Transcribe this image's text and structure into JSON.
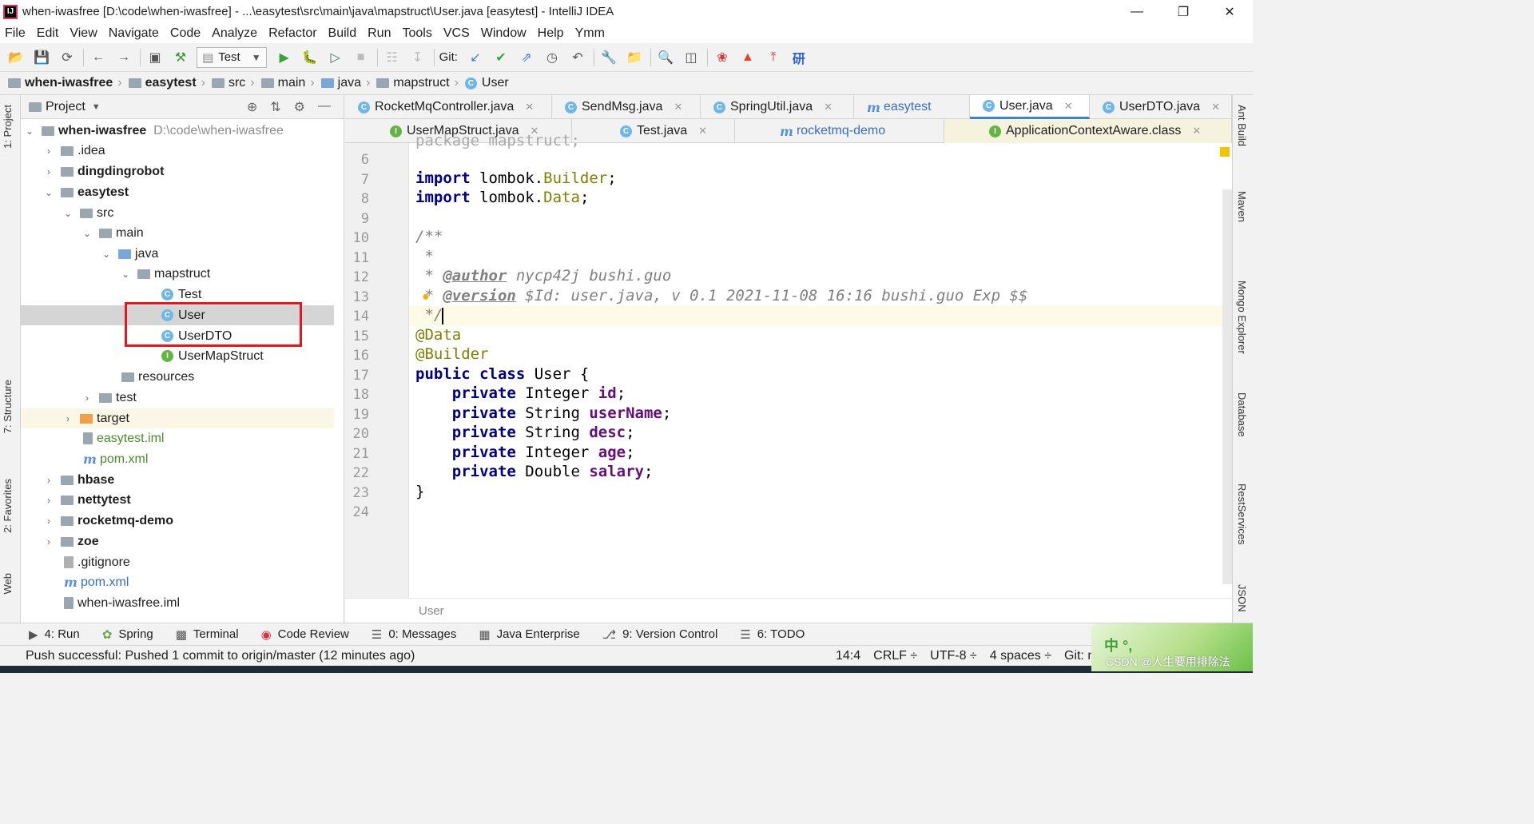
{
  "window": {
    "title": "when-iwasfree [D:\\code\\when-iwasfree] - ...\\easytest\\src\\main\\java\\mapstruct\\User.java [easytest] - IntelliJ IDEA",
    "app_icon": "IJ"
  },
  "menu": [
    "File",
    "Edit",
    "View",
    "Navigate",
    "Code",
    "Analyze",
    "Refactor",
    "Build",
    "Run",
    "Tools",
    "VCS",
    "Window",
    "Help",
    "Ymm"
  ],
  "toolbar": {
    "run_config": "Test",
    "git_label": "Git:"
  },
  "breadcrumb": [
    "when-iwasfree",
    "easytest",
    "src",
    "main",
    "java",
    "mapstruct",
    "User"
  ],
  "left_tool_tabs": [
    "1: Project",
    "7: Structure",
    "2: Favorites",
    "Web"
  ],
  "right_tool_tabs": [
    "Ant Build",
    "Maven",
    "Mongo Explorer",
    "Database",
    "RestServices",
    "JSON"
  ],
  "project_panel": {
    "title": "Project",
    "tree": [
      {
        "label": "when-iwasfree",
        "path": "D:\\code\\when-iwasfree"
      },
      {
        "label": ".idea"
      },
      {
        "label": "dingdingrobot"
      },
      {
        "label": "easytest"
      },
      {
        "label": "src"
      },
      {
        "label": "main"
      },
      {
        "label": "java"
      },
      {
        "label": "mapstruct"
      },
      {
        "label": "Test"
      },
      {
        "label": "User"
      },
      {
        "label": "UserDTO"
      },
      {
        "label": "UserMapStruct"
      },
      {
        "label": "resources"
      },
      {
        "label": "test"
      },
      {
        "label": "target"
      },
      {
        "label": "easytest.iml"
      },
      {
        "label": "pom.xml"
      },
      {
        "label": "hbase"
      },
      {
        "label": "nettytest"
      },
      {
        "label": "rocketmq-demo"
      },
      {
        "label": "zoe"
      },
      {
        "label": ".gitignore"
      },
      {
        "label": "pom.xml"
      },
      {
        "label": "when-iwasfree.iml"
      }
    ]
  },
  "editor_tabs_row1": [
    "RocketMqController.java",
    "SendMsg.java",
    "SpringUtil.java",
    "easytest",
    "User.java",
    "UserDTO.java"
  ],
  "editor_tabs_row2": [
    "UserMapStruct.java",
    "Test.java",
    "rocketmq-demo",
    "ApplicationContextAware.class"
  ],
  "editor": {
    "line_numbers": [
      "6",
      "7",
      "8",
      "9",
      "10",
      "11",
      "12",
      "13",
      "14",
      "15",
      "16",
      "17",
      "18",
      "19",
      "20",
      "21",
      "22",
      "23",
      "24"
    ],
    "cut_line": "package mapstruct;",
    "code": {
      "import1_kw": "import",
      "import1_pkg": "lombok.",
      "import1_cls": "Builder",
      "import2_kw": "import",
      "import2_pkg": "lombok.",
      "import2_cls": "Data",
      "doc_open": "/**",
      "doc_star": " *",
      "author_prefix": " * ",
      "author_tag": "@author",
      "author_text": " nycp42j bushi.guo",
      "version_prefix": " * ",
      "version_tag": "@version",
      "version_text": " $Id: user.java, v 0.1 2021-11-08 16:16 bushi.guo Exp $$",
      "doc_close": " */",
      "ann_data": "@Data",
      "ann_builder": "@Builder",
      "class_kw": "public class",
      "class_name": " User {",
      "fields": [
        {
          "mod": "private",
          "type": " Integer ",
          "name": "id",
          "end": ";"
        },
        {
          "mod": "private",
          "type": " String ",
          "name": "userName",
          "end": ";"
        },
        {
          "mod": "private",
          "type": " String ",
          "name": "desc",
          "end": ";"
        },
        {
          "mod": "private",
          "type": " Integer ",
          "name": "age",
          "end": ";"
        },
        {
          "mod": "private",
          "type": " Double ",
          "name": "salary",
          "end": ";"
        }
      ],
      "close_brace": "}"
    },
    "footer_breadcrumb": "User"
  },
  "bottom_tabs": [
    {
      "label": "4: Run"
    },
    {
      "label": "Spring"
    },
    {
      "label": "Terminal"
    },
    {
      "label": "Code Review"
    },
    {
      "label": "0: Messages"
    },
    {
      "label": "Java Enterprise"
    },
    {
      "label": "9: Version Control"
    },
    {
      "label": "6: TODO"
    }
  ],
  "status": {
    "message": "Push successful: Pushed 1 commit to origin/master (12 minutes ago)",
    "caret_pos": "14:4",
    "line_sep": "CRLF ÷",
    "encoding": "UTF-8 ÷",
    "indent": "4 spaces ÷",
    "vcs": "Git: mas"
  },
  "overlay": {
    "ime_text": "中 °,",
    "watermark": "CSDN @人生要用排除法"
  },
  "colors": {
    "highlight_box": "#e5161e",
    "active_tab_underline": "#4083c9",
    "keyword": "#000080",
    "annotation": "#808000",
    "field": "#660e7a"
  }
}
